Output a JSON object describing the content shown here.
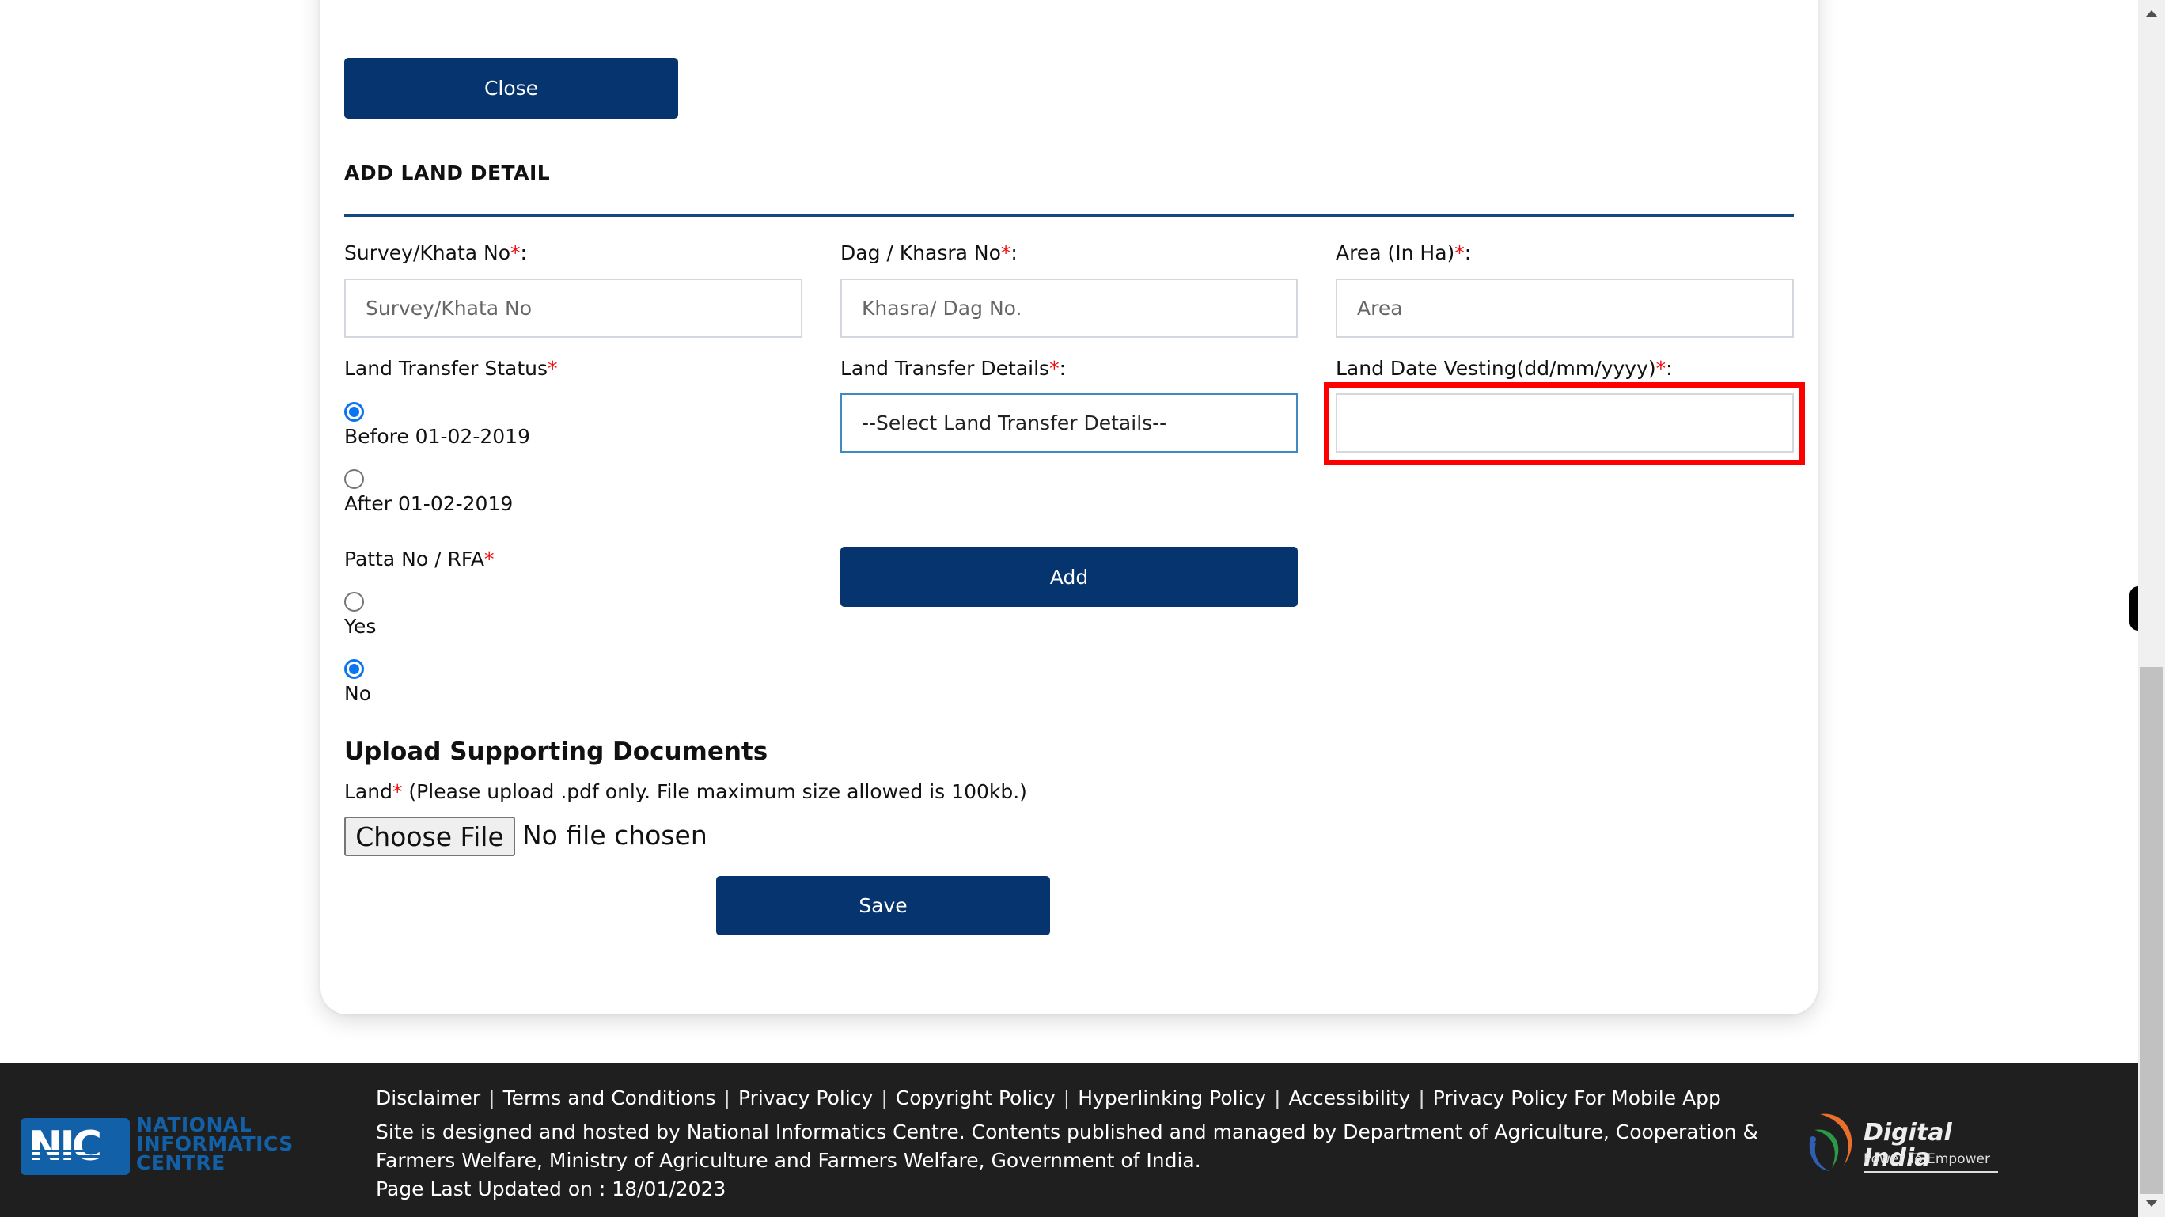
{
  "buttons": {
    "close": "Close",
    "add": "Add",
    "save": "Save"
  },
  "section": {
    "title": "ADD LAND DETAIL"
  },
  "fields": {
    "survey": {
      "label": "Survey/Khata No",
      "required": "*",
      "suffix": ":",
      "placeholder": "Survey/Khata No",
      "value": ""
    },
    "dag": {
      "label": "Dag / Khasra No",
      "required": "*",
      "suffix": ":",
      "placeholder": "Khasra/ Dag No.",
      "value": ""
    },
    "area": {
      "label": "Area (In Ha)",
      "required": "*",
      "suffix": ":",
      "placeholder": "Area",
      "value": ""
    },
    "transfer_status": {
      "label": "Land Transfer Status",
      "required": "*",
      "options": [
        {
          "label": "Before 01-02-2019",
          "checked": true
        },
        {
          "label": "After 01-02-2019",
          "checked": false
        }
      ]
    },
    "transfer_details": {
      "label": "Land Transfer Details",
      "required": "*",
      "suffix": ":",
      "selected": "--Select Land Transfer Details--"
    },
    "date_vesting": {
      "label": "Land Date Vesting(dd/mm/yyyy)",
      "required": "*",
      "suffix": ":",
      "value": "",
      "highlighted": true
    },
    "patta": {
      "label": "Patta No / RFA",
      "required": "*",
      "options": [
        {
          "label": "Yes",
          "checked": false
        },
        {
          "label": "No",
          "checked": true
        }
      ]
    }
  },
  "upload": {
    "title": "Upload Supporting Documents",
    "land_label": "Land",
    "required": "*",
    "hint": " (Please upload .pdf only. File maximum size allowed is 100kb.)",
    "choose_button": "Choose File",
    "status": "No file chosen"
  },
  "footer": {
    "links": [
      "Disclaimer",
      "Terms and Conditions",
      "Privacy Policy",
      "Copyright Policy",
      "Hyperlinking Policy",
      "Accessibility",
      "Privacy Policy For Mobile App"
    ],
    "separator": "|",
    "line1": "Site is designed and hosted by National Informatics Centre. Contents published and managed by Department of Agriculture, Cooperation &",
    "line2": "Farmers Welfare, Ministry of Agriculture and Farmers Welfare, Government of India.",
    "updated": "Page Last Updated on : 18/01/2023",
    "nic_logo": {
      "letters": "NIC",
      "line1": "NATIONAL",
      "line2": "INFORMATICS",
      "line3": "CENTRE"
    },
    "di_logo": {
      "name": "Digital India",
      "tagline": "Power To Empower"
    }
  },
  "colors": {
    "primary": "#06346e",
    "required": "#ee1111",
    "radio_checked": "#0b74f0",
    "highlight": "#ff0000",
    "footer_bg": "#1f1f1f"
  }
}
